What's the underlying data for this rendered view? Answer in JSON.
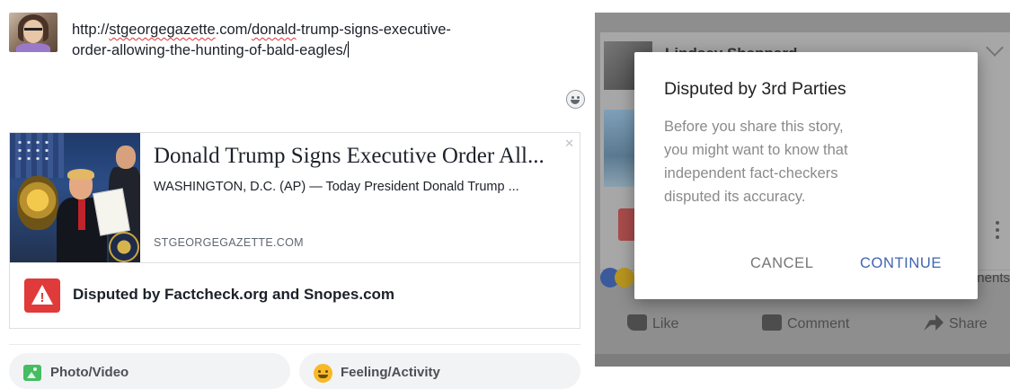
{
  "composer": {
    "url_prefix": "http://",
    "url_domain": "stgeorgegazette",
    "url_mid": ".com/",
    "url_donald": "donald",
    "url_line1_rest": "-trump-signs-executive-",
    "url_line2": "order-allowing-the-hunting-of-bald-eagles/",
    "link_card": {
      "title": "Donald Trump Signs Executive Order All...",
      "description": "WASHINGTON, D.C. (AP) — Today President Donald Trump ...",
      "domain": "STGEORGEGAZETTE.COM",
      "close_glyph": "✕"
    },
    "disputed_notice": "Disputed by Factcheck.org and Snopes.com",
    "actions": {
      "photo_video": "Photo/Video",
      "feeling_activity": "Feeling/Activity"
    }
  },
  "mobile": {
    "poster_name": "Lindsey Sheppard",
    "comments_fragment": "nents",
    "actions": {
      "like": "Like",
      "comment": "Comment",
      "share": "Share"
    },
    "dialog": {
      "title": "Disputed by 3rd Parties",
      "body_lines": [
        "Before you share this story,",
        "you might want to know that",
        "independent fact-checkers",
        "disputed its accuracy."
      ],
      "cancel_label": "CANCEL",
      "continue_label": "CONTINUE"
    }
  },
  "colors": {
    "warning_red": "#e03a3a",
    "continue_blue": "#3f64b0",
    "photo_green": "#45bd62",
    "feeling_yellow": "#f7b928"
  },
  "icons": [
    "avatar",
    "emoji-icon",
    "close-icon",
    "warning-icon",
    "photo-icon",
    "feeling-icon",
    "like-icon",
    "comment-icon",
    "share-icon",
    "more-icon",
    "chevron-down-icon"
  ]
}
